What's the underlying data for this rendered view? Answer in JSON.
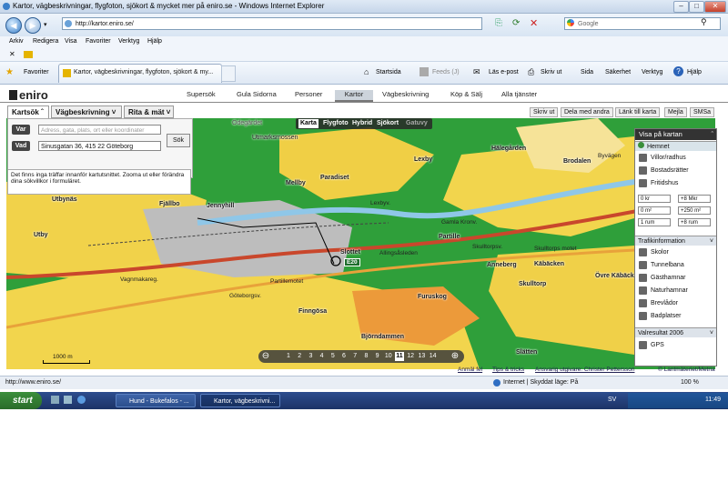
{
  "window": {
    "title": "Kartor, vägbeskrivningar, flygfoton, sjökort & mycket mer på eniro.se - Windows Internet Explorer"
  },
  "browser": {
    "url": "http://kartor.eniro.se/",
    "search_placeholder": "Google",
    "menu": [
      "Arkiv",
      "Redigera",
      "Visa",
      "Favoriter",
      "Verktyg",
      "Hjälp"
    ],
    "favorites_label": "Favoriter",
    "tab_title": "Kartor, vägbeskrivningar, flygfoton, sjökort & my...",
    "tools": [
      "Startsida",
      "Feeds (J)",
      "Läs e-post",
      "Skriv ut",
      "Sida",
      "Säkerhet",
      "Verktyg",
      "Hjälp"
    ]
  },
  "site": {
    "logo": "eniro",
    "nav": [
      "Supersök",
      "Gula Sidorna",
      "Personer",
      "Kartor",
      "Vägbeskrivning",
      "Köp & Sälj",
      "Alla tjänster"
    ],
    "active_nav": "Kartor",
    "map_tabs": [
      "Kartsök",
      "Vägbeskrivning",
      "Rita & mät"
    ],
    "actions": [
      "Skriv ut",
      "Dela med andra",
      "Länk till karta",
      "Mejla",
      "SMSa"
    ]
  },
  "search": {
    "var_label": "Var",
    "var_placeholder": "Adress, gata, plats, ort eller koordinater",
    "vad_label": "Vad",
    "vad_value": "Sinusgatan 36, 415 22 Göteborg",
    "button": "Sök",
    "info": "Det finns inga träffar innanför kartutsnittet. Zooma ut eller förändra dina sökvillkor i formuläret."
  },
  "map_modes": [
    "Karta",
    "Flygfoto",
    "Hybrid",
    "Sjökort",
    "Gatuvy"
  ],
  "map_labels": {
    "areas": [
      "Odegärdet",
      "Utmarksmossen",
      "Hälegården",
      "Lexby",
      "Brodalen",
      "Byvägen",
      "Paradiset",
      "Mellby",
      "Fjällbo",
      "Utbynäs",
      "Jennyhill",
      "Utby",
      "Slottet",
      "Partille",
      "Allingsåsleden",
      "Anneberg",
      "Käbäcken",
      "Skulltorp",
      "Övre Käbäcken",
      "Furuskog",
      "Finngösa",
      "Björndammen",
      "Slätten",
      "Partillemotet",
      "Göteborgsv.",
      "Vagnmakareg.",
      "Lexbyv.",
      "Skulltorps motet",
      "Gamla Kronv.",
      "Skulltorpsv.",
      "E20"
    ],
    "scale": "1000 m"
  },
  "right_panel": {
    "title": "Visa på kartan",
    "hemnet_label": "Hemnet",
    "hemnet_items": [
      "Villor/radhus",
      "Bostadsrätter",
      "Fritidshus"
    ],
    "filters": [
      [
        "0 kr",
        "+8 Mkr"
      ],
      [
        "0 m²",
        "+250 m²"
      ],
      [
        "1 rum",
        "+8 rum"
      ]
    ],
    "traffic_label": "Trafikinformation",
    "poi_items": [
      "Skolor",
      "Tunnelbana",
      "Gästhamnar",
      "Naturhamnar",
      "Brevlådor",
      "Badplatser"
    ],
    "election_label": "Valresultat 2006",
    "gps_label": "GPS"
  },
  "zoom": {
    "levels": [
      "1",
      "2",
      "3",
      "4",
      "5",
      "6",
      "7",
      "8",
      "9",
      "10",
      "11",
      "12",
      "13",
      "14"
    ],
    "active": "11"
  },
  "footer": {
    "links": [
      "Anmäl fel",
      "Tips & tricks",
      "Ansvarig utgivare: Christer Pettersson",
      "© Lantmäteriet/Metria"
    ],
    "status_url": "http://www.eniro.se/",
    "zone": "Internet | Skyddat läge: På",
    "zoom": "100 %"
  },
  "taskbar": {
    "start": "start",
    "tasks": [
      "Hund - Bukefalos - ...",
      "Kartor, vägbeskrivni..."
    ],
    "lang": "SV",
    "clock": "11:49"
  }
}
